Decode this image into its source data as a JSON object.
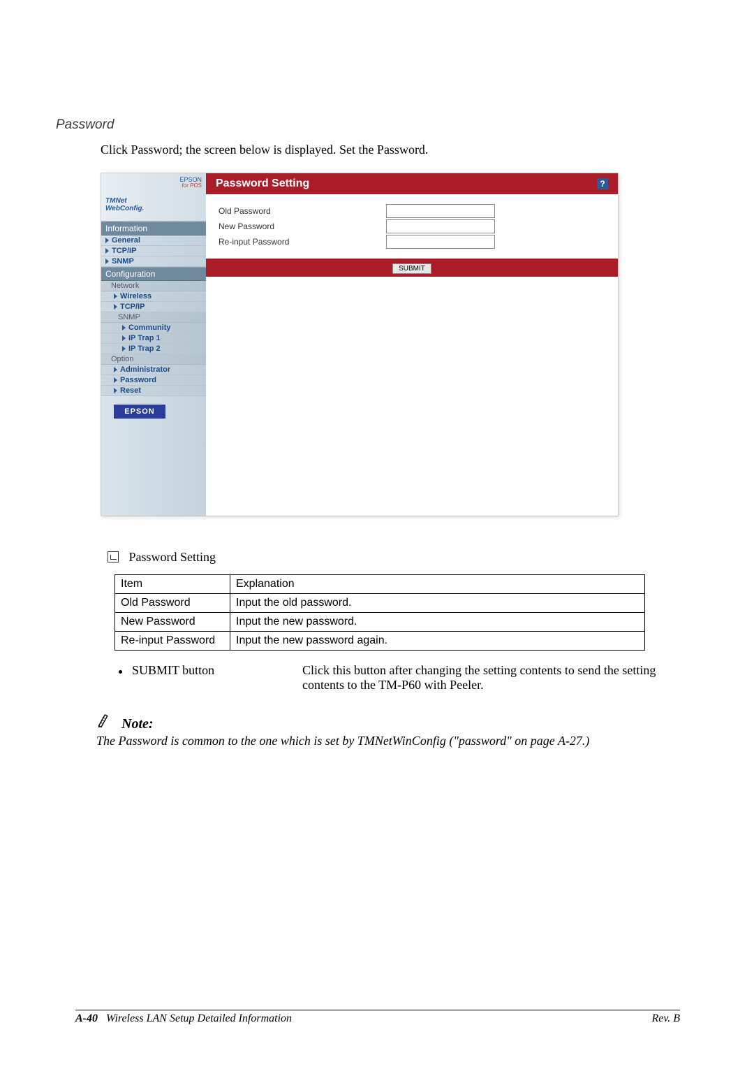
{
  "section": {
    "title": "Password",
    "intro": "Click Password; the screen below is displayed. Set the Password."
  },
  "screenshot": {
    "logo": {
      "epson": "EPSON",
      "forpos": "for POS",
      "tmnet": "TMNet",
      "webconfig": "WebConfig."
    },
    "nav": {
      "information_header": "Information",
      "info_items": [
        "General",
        "TCP/IP",
        "SNMP"
      ],
      "configuration_header": "Configuration",
      "network_label": "Network",
      "network_items": [
        "Wireless",
        "TCP/IP"
      ],
      "snmp_label": "SNMP",
      "snmp_items": [
        "Community",
        "IP Trap 1",
        "IP Trap 2"
      ],
      "option_label": "Option",
      "option_items": [
        "Administrator",
        "Password"
      ],
      "reset_item": "Reset"
    },
    "epson_badge": "EPSON",
    "panel": {
      "title": "Password Setting",
      "labels": {
        "old": "Old Password",
        "new": "New Password",
        "reinput": "Re-input Password"
      },
      "submit_label": "SUBMIT"
    }
  },
  "subsection": {
    "title": "Password Setting"
  },
  "table": {
    "headers": {
      "item": "Item",
      "explanation": "Explanation"
    },
    "rows": [
      {
        "item": "Old Password",
        "explanation": "Input the old password."
      },
      {
        "item": "New Password",
        "explanation": "Input the new password."
      },
      {
        "item": "Re-input Password",
        "explanation": "Input the new password again."
      }
    ]
  },
  "submit_explain": {
    "label": "SUBMIT button",
    "desc": "Click this button after changing the setting contents to send the setting contents to the TM-P60 with Peeler."
  },
  "note": {
    "word": "Note:",
    "text": "The Password is common to the one which is set by TMNetWinConfig (\"password\" on page A-27.)"
  },
  "footer": {
    "page_num": "A-40",
    "title": "Wireless LAN Setup Detailed Information",
    "rev": "Rev. B"
  }
}
